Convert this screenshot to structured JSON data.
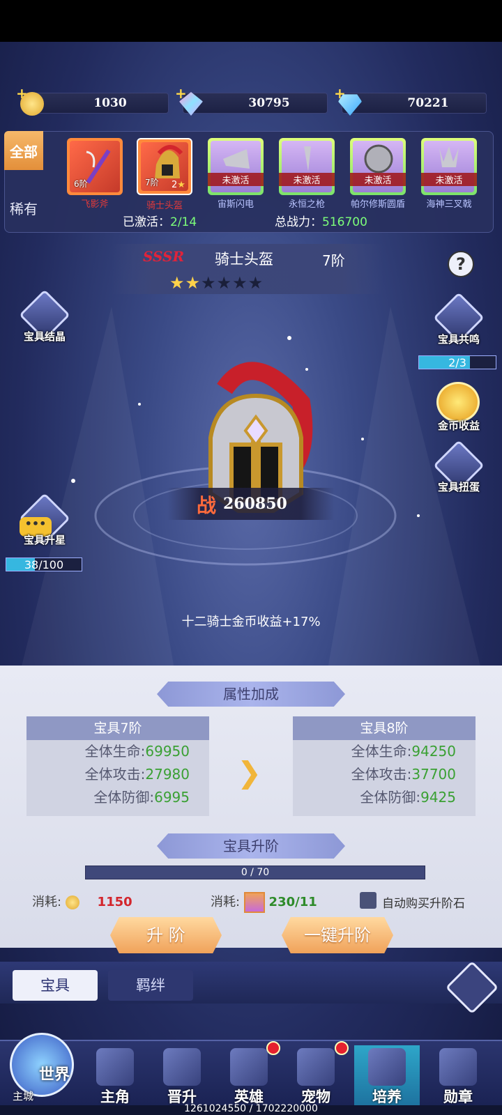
{
  "currency": {
    "gold": "1030",
    "crystal": "30795",
    "diamond": "70221"
  },
  "tabs": {
    "all": "全部",
    "rare": "稀有"
  },
  "treasures": [
    {
      "level": "6阶",
      "name": "飞影斧",
      "inactive": ""
    },
    {
      "level": "7阶",
      "name": "骑士头盔",
      "inactive": ""
    },
    {
      "level": "",
      "name": "宙斯闪电",
      "inactive": "未激活"
    },
    {
      "level": "",
      "name": "永恒之枪",
      "inactive": "未激活"
    },
    {
      "level": "",
      "name": "帕尔修斯圆盾",
      "inactive": "未激活"
    },
    {
      "level": "",
      "name": "海神三叉戟",
      "inactive": "未激活"
    }
  ],
  "summary": {
    "activated_label": "已激活：",
    "activated_value": "2/14",
    "power_label": "总战力：",
    "power_value": "516700"
  },
  "treasure": {
    "rarity": "SSSR",
    "name": "骑士头盔",
    "level": "7阶",
    "stars_filled": 2,
    "stars_total": 6,
    "star_glyph": "★",
    "power_glyph": "战",
    "power": "260850",
    "bonus": "十二骑士金币收益+17%"
  },
  "side": {
    "crystal": "宝具结晶",
    "upstar": "宝具升星",
    "upstar_progress": "38/100",
    "upstar_fraction": 0.38,
    "resonance": "宝具共鸣",
    "resonance_progress": "2/3",
    "resonance_fraction": 0.667,
    "gold_income": "金币收益",
    "gacha": "宝具扭蛋",
    "help": "?"
  },
  "attrs": {
    "title": "属性加成",
    "current": {
      "title": "宝具7阶",
      "rows": [
        {
          "label": "全体生命:",
          "value": "69950"
        },
        {
          "label": "全体攻击:",
          "value": "27980"
        },
        {
          "label": "全体防御:",
          "value": "6995"
        }
      ]
    },
    "next": {
      "title": "宝具8阶",
      "rows": [
        {
          "label": "全体生命:",
          "value": "94250"
        },
        {
          "label": "全体攻击:",
          "value": "37700"
        },
        {
          "label": "全体防御:",
          "value": "9425"
        }
      ]
    }
  },
  "upgrade": {
    "title": "宝具升阶",
    "progress": "0 / 70",
    "progress_fraction": 0.0,
    "cost_label": "消耗:",
    "gold_cost": "1150",
    "item_cost": "230/11",
    "auto_buy": "自动购买升阶石",
    "btn_up": "升 阶",
    "btn_oneclick": "一键升阶"
  },
  "subtabs": {
    "treasure": "宝具",
    "bond": "羁绊"
  },
  "nav": [
    {
      "label": "主角"
    },
    {
      "label": "晋升"
    },
    {
      "label": "英雄"
    },
    {
      "label": "宠物"
    },
    {
      "label": "培养"
    },
    {
      "label": "勋章"
    }
  ],
  "world": {
    "label": "世界",
    "sub": "主城"
  },
  "footer": "1261024550 / 1702220000",
  "colors": {
    "accent": "#36b7e0",
    "green": "#3aa033",
    "red": "#e0233a"
  }
}
